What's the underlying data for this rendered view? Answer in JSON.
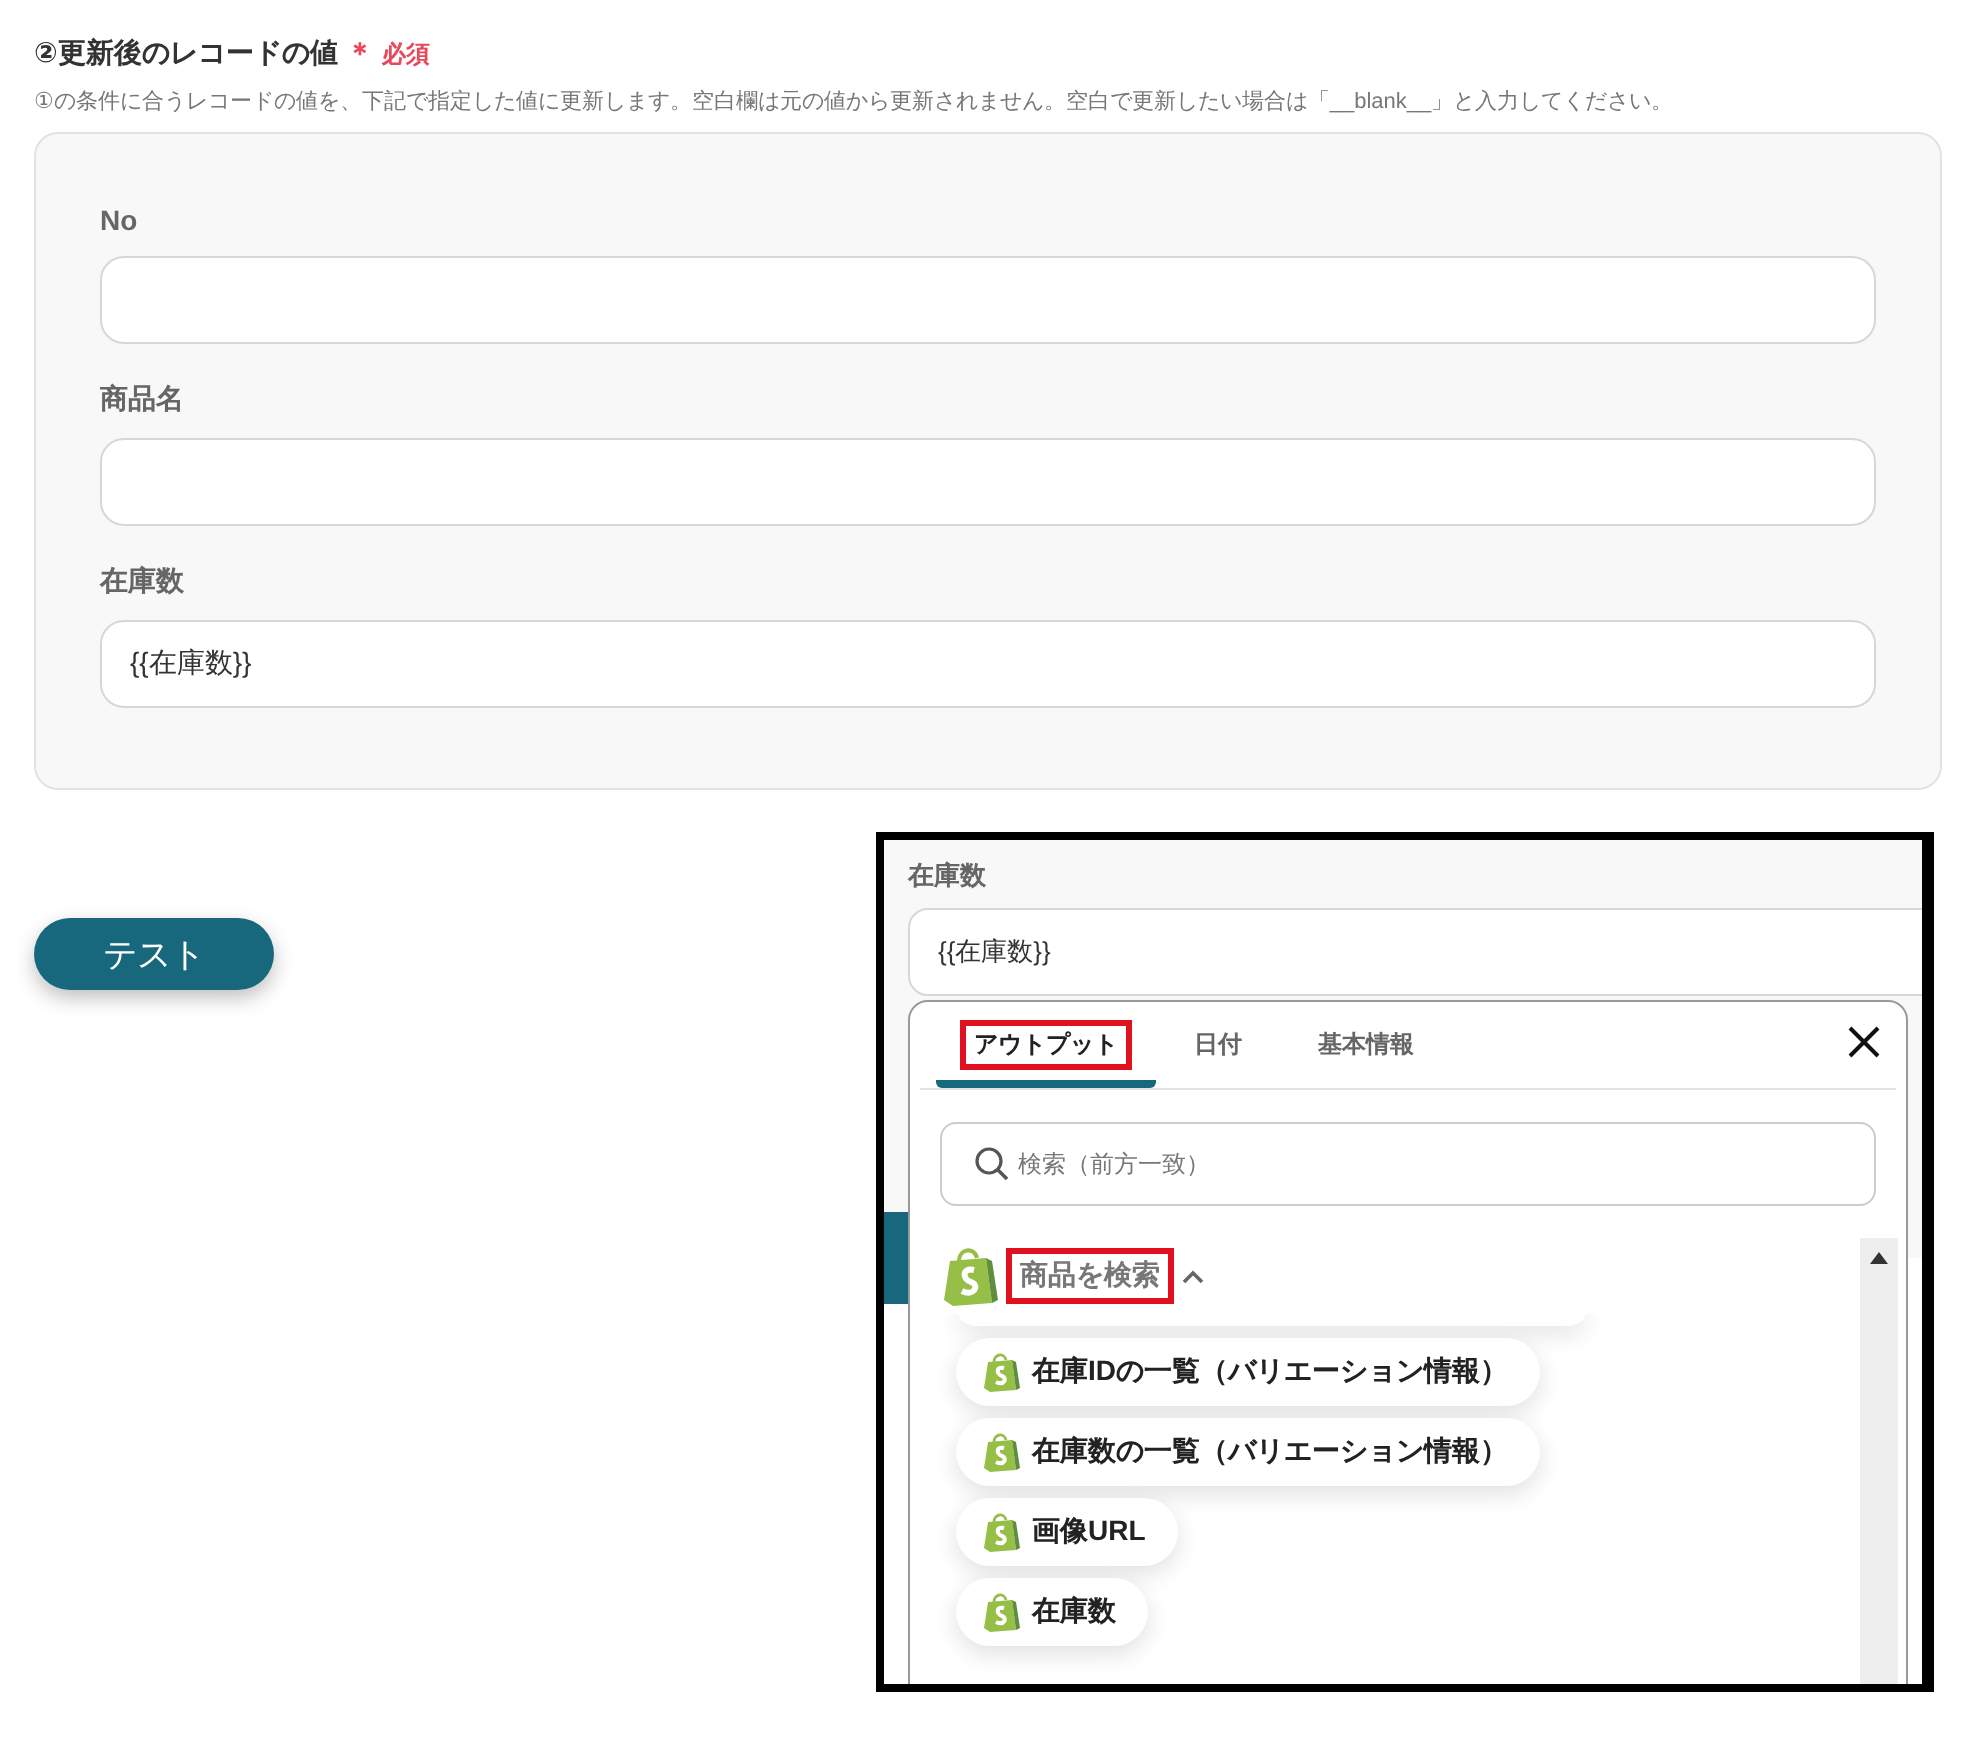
{
  "section": {
    "title": "②更新後のレコードの値",
    "required_mark": "＊",
    "required_label": "必須",
    "description": "①の条件に合うレコードの値を、下記で指定した値に更新します。空白欄は元の値から更新されません。空白で更新したい場合は「__blank__」と入力してください。",
    "fields": [
      {
        "label": "No"
      },
      {
        "label": "商品名"
      },
      {
        "label": "在庫数",
        "value": "{{在庫数}}"
      }
    ]
  },
  "test_button": "テスト",
  "inset": {
    "field": {
      "label": "在庫数",
      "value": "{{在庫数}}"
    },
    "tabs": [
      {
        "label": "アウトプット",
        "selected": true,
        "highlighted": true
      },
      {
        "label": "日付",
        "selected": false,
        "highlighted": false
      },
      {
        "label": "基本情報",
        "selected": false,
        "highlighted": false
      }
    ],
    "search": {
      "placeholder": "検索（前方一致）"
    },
    "group": {
      "title": "商品を検索",
      "highlighted": true,
      "expanded": true,
      "items": [
        {
          "label": "在庫IDの一覧（バリエーション情報）"
        },
        {
          "label": "在庫数の一覧（バリエーション情報）"
        },
        {
          "label": "画像URL"
        },
        {
          "label": "在庫数"
        }
      ]
    }
  }
}
